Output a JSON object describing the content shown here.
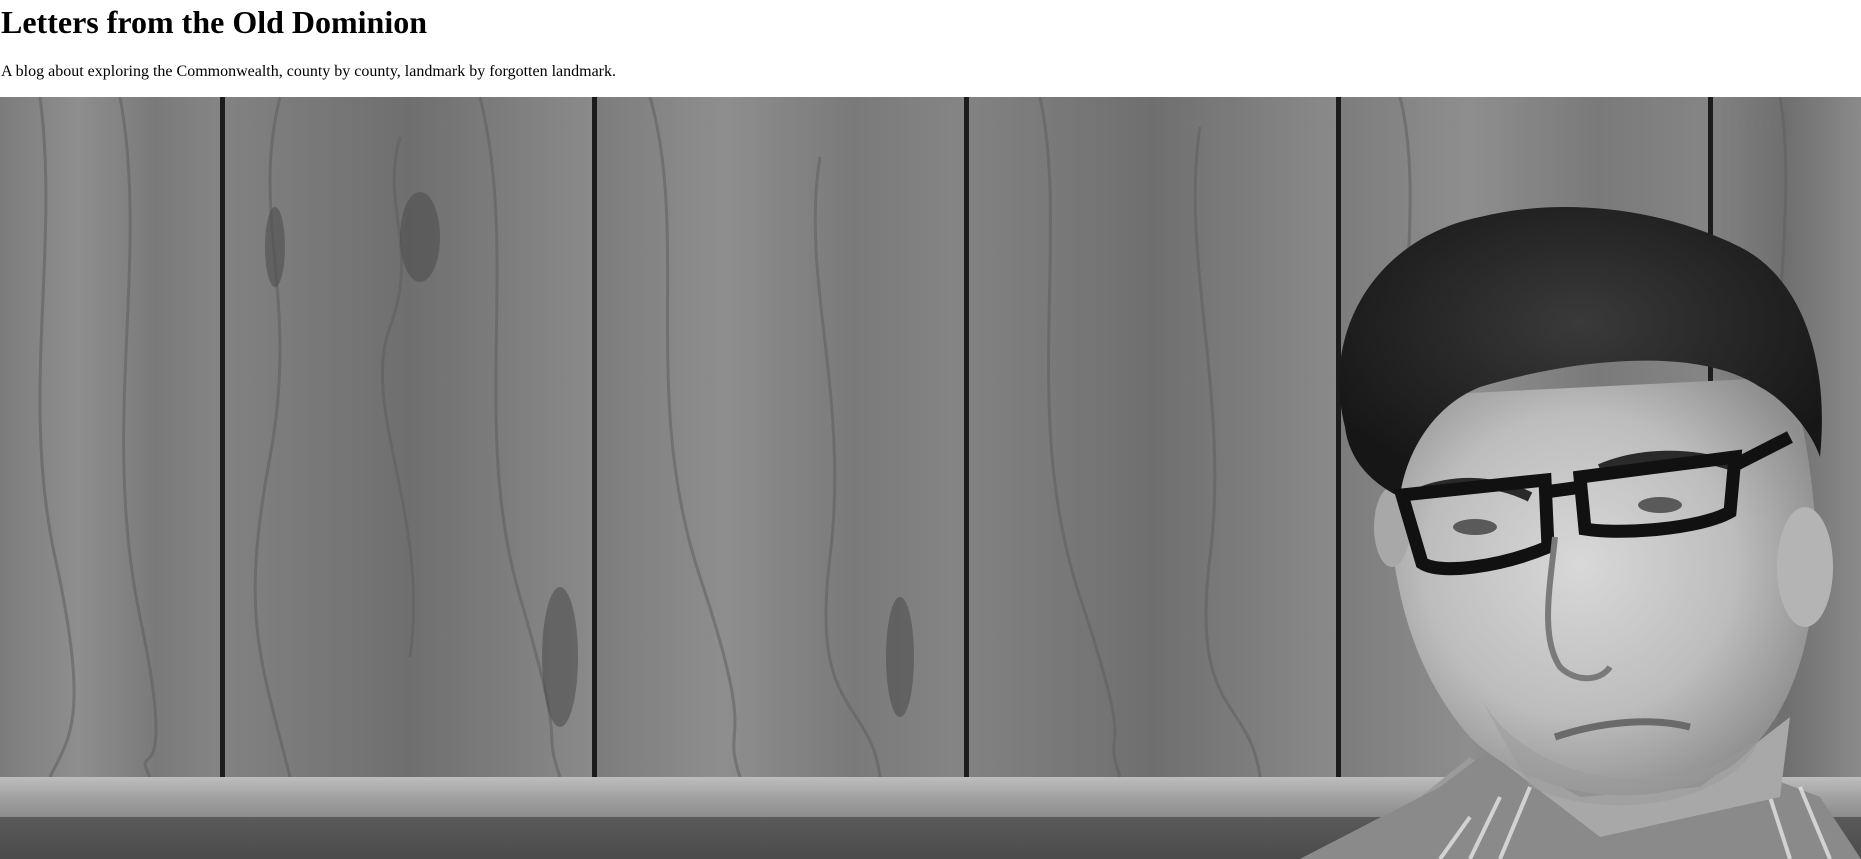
{
  "header": {
    "title": "Letters from the Old Dominion",
    "tagline": "A blog about exploring the Commonwealth, county by county, landmark by forgotten landmark."
  },
  "hero": {
    "image": "grayscale-portrait-man-glasses-wood-panel-wall",
    "colors": {
      "wood_light": "#8a8a8a",
      "wood_dark": "#4a4a4a",
      "seam": "#1c1c1c",
      "ledge": "#a9a9a9"
    }
  }
}
